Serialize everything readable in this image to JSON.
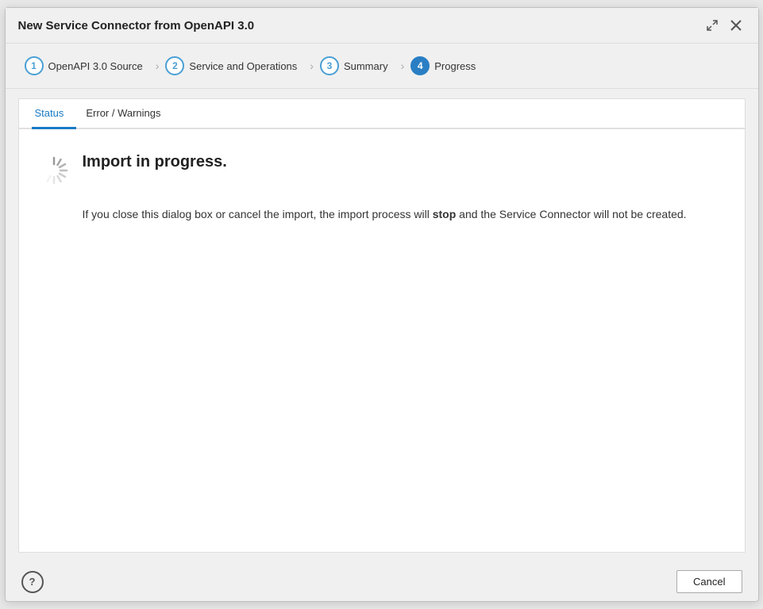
{
  "dialog": {
    "title": "New Service Connector from OpenAPI 3.0",
    "expand_icon": "expand-icon",
    "close_icon": "close-icon"
  },
  "wizard": {
    "steps": [
      {
        "number": "1",
        "label": "OpenAPI 3.0 Source",
        "active": false
      },
      {
        "number": "2",
        "label": "Service and Operations",
        "active": false
      },
      {
        "number": "3",
        "label": "Summary",
        "active": false
      },
      {
        "number": "4",
        "label": "Progress",
        "active": true
      }
    ]
  },
  "tabs": [
    {
      "label": "Status",
      "active": true
    },
    {
      "label": "Error / Warnings",
      "active": false
    }
  ],
  "content": {
    "import_title": "Import in progress.",
    "import_body_before_stop": "If you close this dialog box or cancel the import, the import process will ",
    "import_stop_word": "stop",
    "import_body_after_stop": " and the Service Connector will not be created."
  },
  "footer": {
    "help_label": "?",
    "cancel_label": "Cancel"
  }
}
